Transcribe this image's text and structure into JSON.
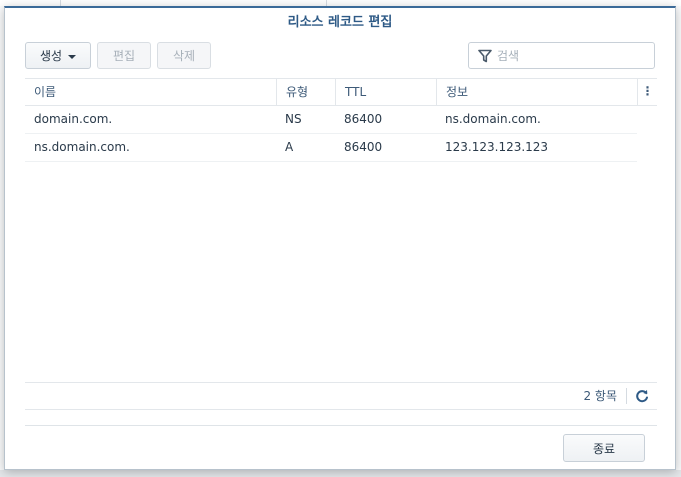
{
  "dialog": {
    "title": "리소스 레코드 편집"
  },
  "toolbar": {
    "create_label": "생성",
    "edit_label": "편집",
    "delete_label": "삭제",
    "search_placeholder": "검색"
  },
  "grid": {
    "headers": [
      "이름",
      "유형",
      "TTL",
      "정보"
    ],
    "rows": [
      [
        "domain.com.",
        "NS",
        "86400",
        "ns.domain.com."
      ],
      [
        "ns.domain.com.",
        "A",
        "86400",
        "123.123.123.123"
      ]
    ],
    "column_menu_icon": "vertical-ellipsis-icon"
  },
  "footer": {
    "count_label": "2 항목",
    "refresh_icon": "refresh-icon",
    "close_label": "종료"
  },
  "icons": {
    "filter": "filter-icon"
  },
  "colors": {
    "accent": "#2e5a86",
    "header_text": "#3d5a78",
    "title_bar_line": "#3b6a98"
  }
}
